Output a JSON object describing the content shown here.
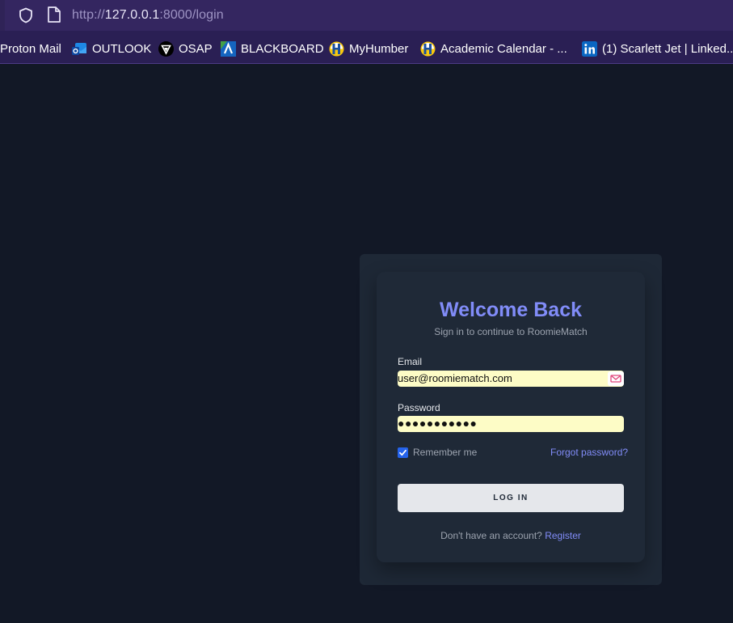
{
  "address_bar": {
    "url_prefix": "http://",
    "url_host": "127.0.0.1",
    "url_rest": ":8000/login",
    "shield_icon": "shield-icon",
    "page_icon": "page-icon"
  },
  "bookmarks": [
    {
      "label": "Proton Mail",
      "icon": ""
    },
    {
      "label": "OUTLOOK",
      "icon": "outlook-icon"
    },
    {
      "label": "OSAP",
      "icon": "osap-icon"
    },
    {
      "label": "BLACKBOARD",
      "icon": "blackboard-icon"
    },
    {
      "label": "MyHumber",
      "icon": "humber-icon"
    },
    {
      "label": "Academic Calendar - ...",
      "icon": "humber-icon"
    },
    {
      "label": "(1) Scarlett Jet | Linked...",
      "icon": "linkedin-icon"
    }
  ],
  "login": {
    "title": "Welcome Back",
    "subtitle": "Sign in to continue to RoomieMatch",
    "email_label": "Email",
    "email_value": "user@roomiematch.com",
    "password_label": "Password",
    "password_value": "●●●●●●●●●●●",
    "remember_label": "Remember me",
    "remember_checked": true,
    "forgot_link": "Forgot password?",
    "submit_label": "LOG IN",
    "register_prompt": "Don't have an account?",
    "register_link": "Register"
  },
  "colors": {
    "page_bg": "#121826",
    "card_bg": "#1f2937",
    "accent": "#818cf8",
    "autofill_bg": "#fdfcc6"
  }
}
